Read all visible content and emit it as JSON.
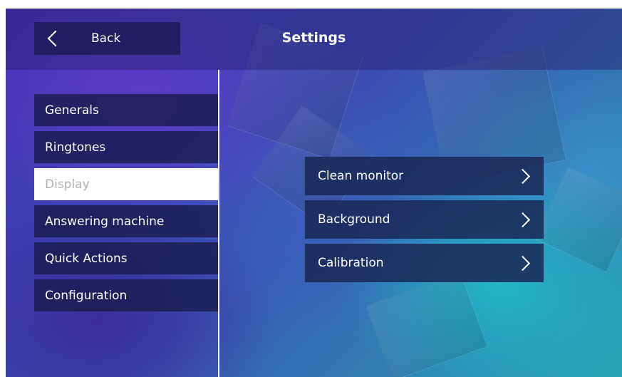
{
  "header": {
    "back_label": "Back",
    "title": "Settings"
  },
  "menu": {
    "items": [
      {
        "label": "Generals",
        "active": false
      },
      {
        "label": "Ringtones",
        "active": false
      },
      {
        "label": "Display",
        "active": true
      },
      {
        "label": "Answering machine",
        "active": false
      },
      {
        "label": "Quick Actions",
        "active": false
      },
      {
        "label": "Configuration",
        "active": false
      }
    ]
  },
  "display_options": [
    {
      "label": "Clean monitor",
      "icon": "chevron-right-icon"
    },
    {
      "label": "Background",
      "icon": "chevron-right-icon"
    },
    {
      "label": "Calibration",
      "icon": "chevron-right-icon"
    }
  ],
  "icons": {
    "back": "chevron-left-icon"
  },
  "colors": {
    "menu_active_bg": "#ffffff",
    "menu_active_text": "#b3b3b3",
    "menu_bg": "#1c1c52",
    "back_button_bg": "#231d62"
  }
}
